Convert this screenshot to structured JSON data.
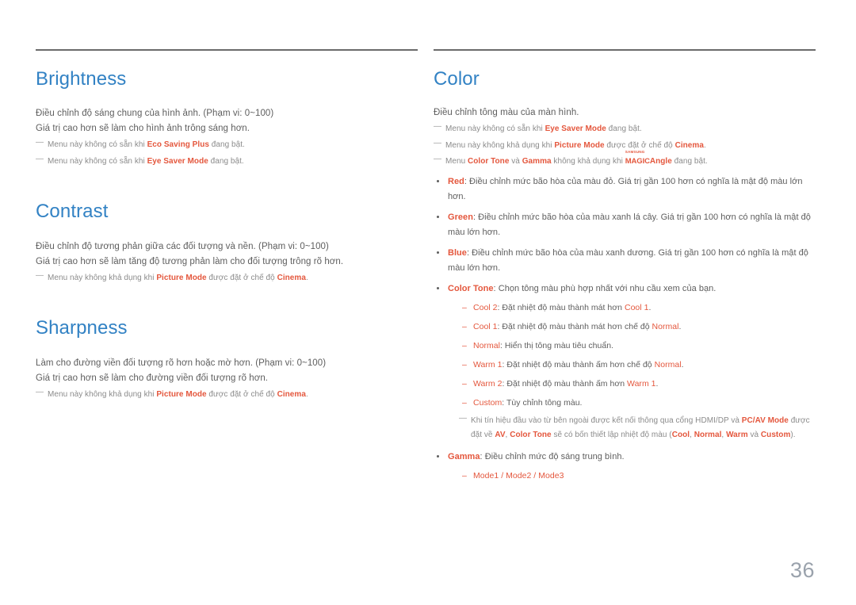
{
  "page": {
    "number": "36",
    "accent_color": "#e4573d",
    "heading_color": "#3282c4",
    "body_color": "#5e5e5e",
    "note_color": "#8b8b8b",
    "rule_color": "#6b6b6b"
  },
  "left_column": {
    "sections": [
      {
        "title": "Brightness",
        "paragraphs": [
          "Điều chỉnh độ sáng chung của hình ảnh. (Phạm vi: 0~100)",
          "Giá trị cao hơn sẽ làm cho hình ảnh trông sáng hơn."
        ],
        "notes": [
          {
            "pre": "Menu này không có sẵn khi ",
            "term": "Eco Saving Plus",
            "post": " đang bật."
          },
          {
            "pre": "Menu này không có sẵn khi ",
            "term": "Eye Saver Mode",
            "post": " đang bật."
          }
        ]
      },
      {
        "title": "Contrast",
        "paragraphs": [
          "Điều chỉnh độ tương phản giữa các đối tượng và nền. (Phạm vi: 0~100)",
          "Giá trị cao hơn sẽ làm tăng độ tương phản làm cho đối tượng trông rõ hơn."
        ],
        "notes": [
          {
            "pre": "Menu này không khả dụng khi ",
            "term": "Picture Mode",
            "mid": " được đặt ở chế độ ",
            "term2": "Cinema",
            "post": "."
          }
        ]
      },
      {
        "title": "Sharpness",
        "paragraphs": [
          "Làm cho đường viền đối tượng rõ hơn hoặc mờ hơn. (Phạm vi: 0~100)",
          "Giá trị cao hơn sẽ làm cho đường viền đối tượng rõ hơn."
        ],
        "notes": [
          {
            "pre": "Menu này không khả dụng khi ",
            "term": "Picture Mode",
            "mid": " được đặt ở chế độ ",
            "term2": "Cinema",
            "post": "."
          }
        ]
      }
    ]
  },
  "right_column": {
    "title": "Color",
    "intro": "Điều chỉnh tông màu của màn hình.",
    "notes": [
      {
        "pre": "Menu này không có sẵn khi ",
        "term": "Eye Saver Mode",
        "post": " đang bật."
      },
      {
        "pre": "Menu này không khả dụng khi ",
        "term": "Picture Mode",
        "mid": " được đặt ở chế độ ",
        "term2": "Cinema",
        "post": "."
      },
      {
        "pre": "Menu ",
        "term": "Color Tone",
        "mid": " và ",
        "term2": "Gamma",
        "mid2": " không khả dụng khi ",
        "logo_brand": "SAMSUNG",
        "logo_magic": "MAGIC",
        "logo_word": "Angle",
        "post": " đang bật."
      }
    ],
    "bullets": [
      {
        "term": "Red",
        "text": ": Điều chỉnh mức bão hòa của màu đỏ. Giá trị gần 100 hơn có nghĩa là mật độ màu lớn hơn."
      },
      {
        "term": "Green",
        "text": ": Điều chỉnh mức bão hòa của màu xanh lá cây. Giá trị gần 100 hơn có nghĩa là mật độ màu lớn hơn."
      },
      {
        "term": "Blue",
        "text": ": Điều chỉnh mức bão hòa của màu xanh dương. Giá trị gần 100 hơn có nghĩa là mật độ màu lớn hơn."
      }
    ],
    "color_tone": {
      "term": "Color Tone",
      "text": ": Chọn tông màu phù hợp nhất với nhu cầu xem của bạn.",
      "options": [
        {
          "name": "Cool 2",
          "pre": ": Đặt nhiệt độ màu thành mát hơn ",
          "ref": "Cool 1",
          "post": "."
        },
        {
          "name": "Cool 1",
          "pre": ": Đặt nhiệt độ màu thành mát hơn chế độ ",
          "ref": "Normal",
          "post": "."
        },
        {
          "name": "Normal",
          "pre": ": Hiển thị tông màu tiêu chuẩn.",
          "ref": "",
          "post": ""
        },
        {
          "name": "Warm 1",
          "pre": ": Đặt nhiệt độ màu thành ấm hơn chế độ ",
          "ref": "Normal",
          "post": "."
        },
        {
          "name": "Warm 2",
          "pre": ": Đặt nhiệt độ màu thành ấm hơn ",
          "ref": "Warm 1",
          "post": "."
        },
        {
          "name": "Custom",
          "pre": ": Tùy chỉnh tông màu.",
          "ref": "",
          "post": ""
        }
      ],
      "note": {
        "p1": "Khi tín hiệu đầu vào từ bên ngoài được kết nối thông qua cổng HDMI/DP và ",
        "t1": "PC/AV Mode",
        "p2": " được đặt về ",
        "t2": "AV",
        "p3": ", ",
        "t3": "Color Tone",
        "p4": " sẽ có bốn thiết lập nhiệt độ màu (",
        "o1": "Cool",
        "p5": ", ",
        "o2": "Normal",
        "p6": ", ",
        "o3": "Warm",
        "p7": " và ",
        "o4": "Custom",
        "p8": ")."
      }
    },
    "gamma": {
      "term": "Gamma",
      "text": ": Điều chỉnh mức độ sáng trung bình.",
      "modes": "Mode1 / Mode2 / Mode3"
    }
  }
}
